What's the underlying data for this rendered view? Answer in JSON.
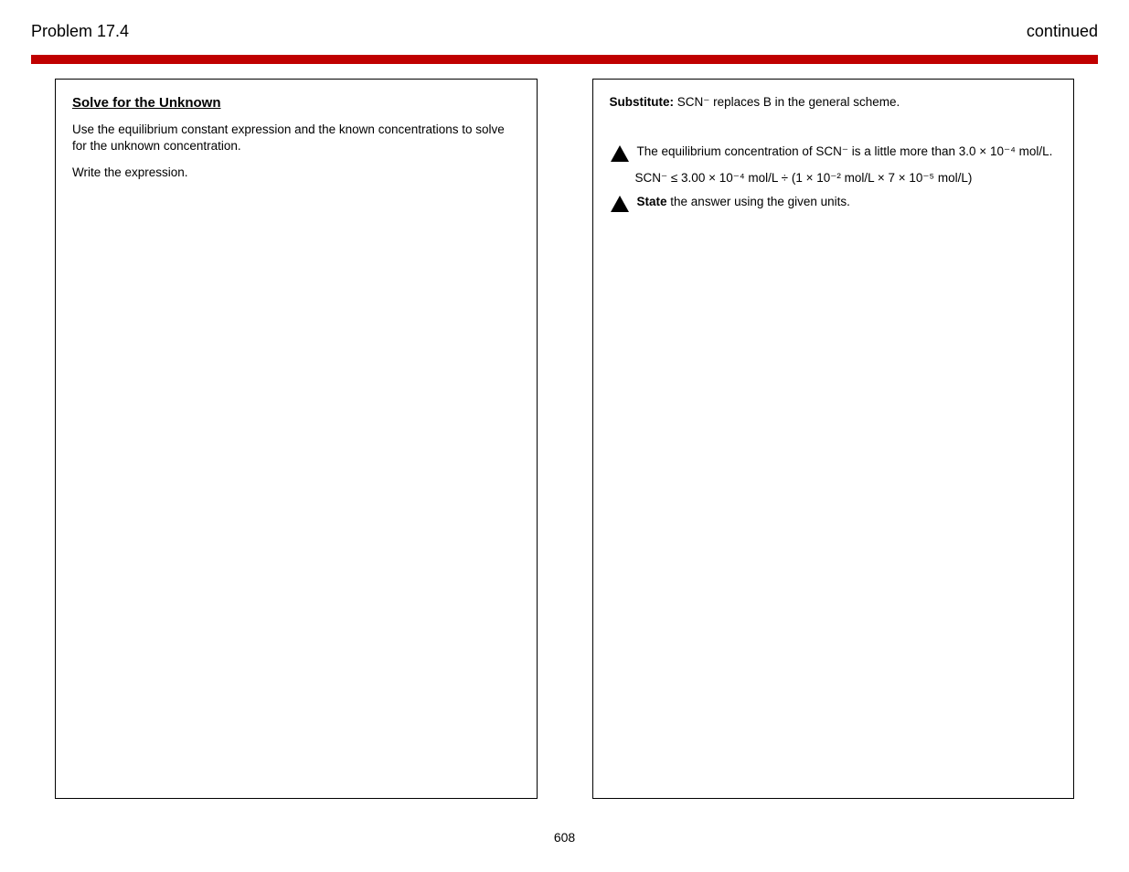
{
  "header": {
    "left": "Problem 17.4",
    "right": "continued"
  },
  "left_col": {
    "heading": "Solve for the Unknown",
    "p1": "Use the equilibrium constant expression and the known concentrations to solve for the unknown concentration.",
    "p2_label": "Write the expression.",
    "p2_value": ""
  },
  "right_col": {
    "p1_label": "Substitute: ",
    "p1_rest": "SCN⁻ replaces B in the general scheme.",
    "b1_prefix": "The ",
    "b1_rest": "equilibrium concentration of SCN⁻ is a little more than 3.0 × 10⁻⁴ mol/L.",
    "b2_prefix": "SCN⁻ ≤ ",
    "b2_rest": "3.00 × 10⁻⁴ mol/L ÷ (1 × 10⁻² mol/L × 7 × 10⁻⁵ mol/L)",
    "b3_prefix": "State",
    "b3_rest": " the answer using the given units."
  },
  "page_number": "608"
}
